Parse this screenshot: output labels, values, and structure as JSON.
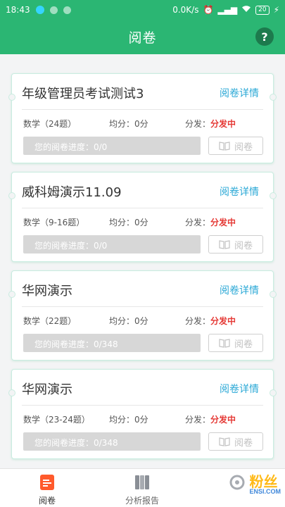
{
  "status_bar": {
    "time": "18:43",
    "speed": "0.0K/s",
    "battery": "20"
  },
  "header": {
    "title": "阅卷",
    "help_label": "?"
  },
  "cards": [
    {
      "title": "年级管理员考试测试3",
      "detail_label": "阅卷详情",
      "subject": "数学（24题）",
      "average": "均分：0分",
      "distribute_label": "分发：",
      "distribute_state": "分发中",
      "progress_text": "您的阅卷进度：0/0",
      "progress_fraction": 0,
      "review_label": "阅卷"
    },
    {
      "title": "威科姆演示11.09",
      "detail_label": "阅卷详情",
      "subject": "数学（9-16题）",
      "average": "均分：0分",
      "distribute_label": "分发：",
      "distribute_state": "分发中",
      "progress_text": "您的阅卷进度：0/0",
      "progress_fraction": 0,
      "review_label": "阅卷"
    },
    {
      "title": "华网演示",
      "detail_label": "阅卷详情",
      "subject": "数学（22题）",
      "average": "均分：0分",
      "distribute_label": "分发：",
      "distribute_state": "分发中",
      "progress_text": "您的阅卷进度：0/348",
      "progress_fraction": 0,
      "review_label": "阅卷"
    },
    {
      "title": "华网演示",
      "detail_label": "阅卷详情",
      "subject": "数学（23-24题）",
      "average": "均分：0分",
      "distribute_label": "分发：",
      "distribute_state": "分发中",
      "progress_text": "您的阅卷进度：0/348",
      "progress_fraction": 0,
      "review_label": "阅卷"
    }
  ],
  "bottom_nav": {
    "items": [
      {
        "label": "阅卷",
        "icon": "review-icon",
        "active": true
      },
      {
        "label": "分析报告",
        "icon": "report-icon",
        "active": false
      }
    ]
  },
  "watermark": {
    "text": "粉丝",
    "sub": "ENSI.COM"
  },
  "colors": {
    "brand": "#2bb673",
    "link": "#2aa8d6",
    "state": "#e53935"
  }
}
